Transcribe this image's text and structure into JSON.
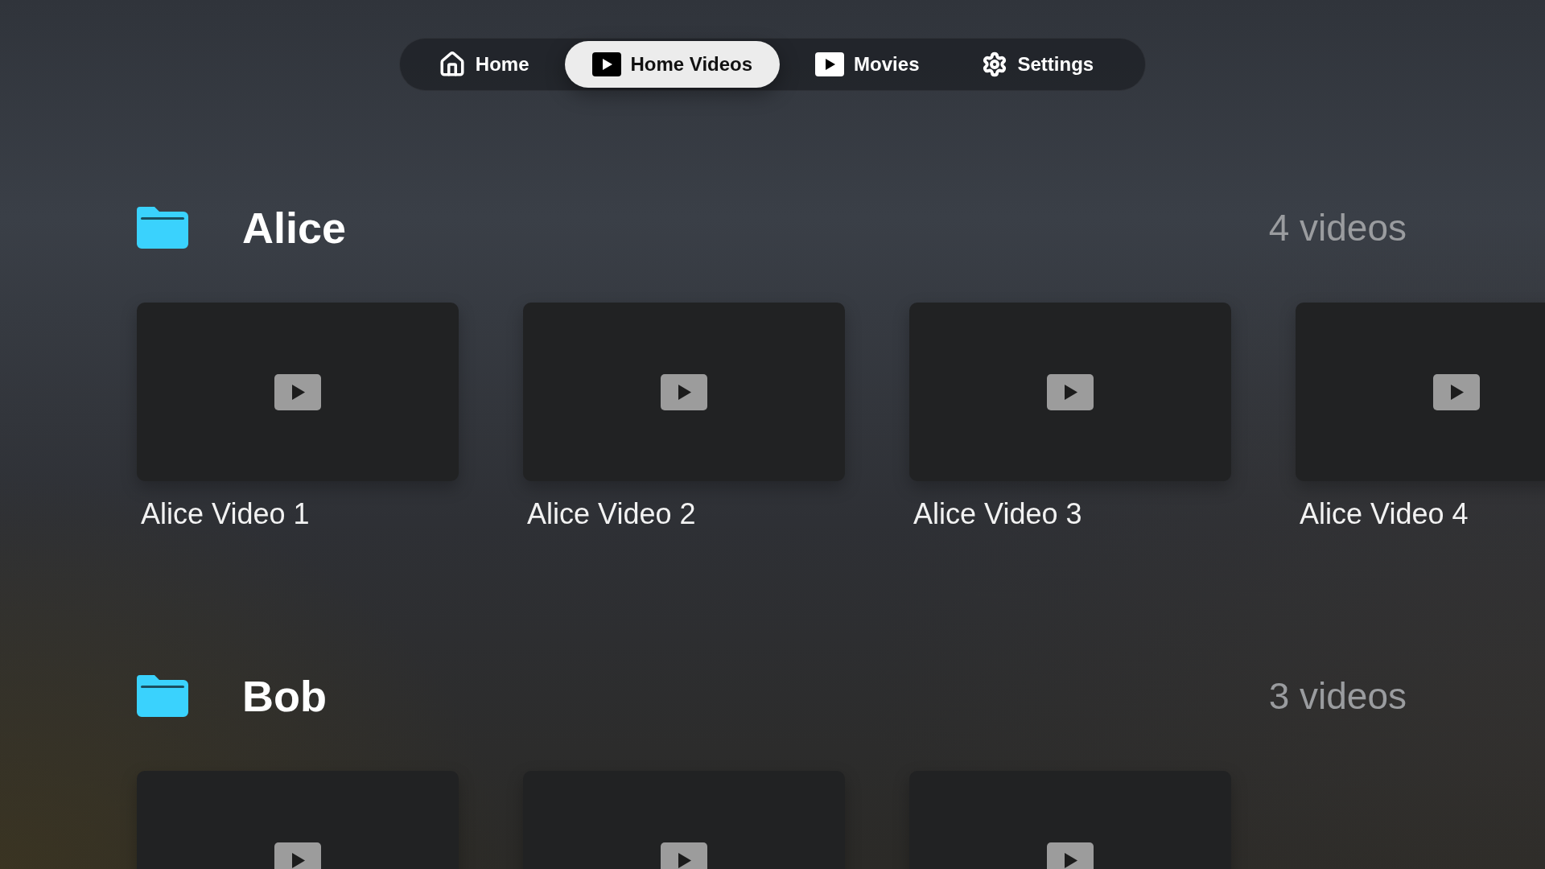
{
  "tabs": [
    {
      "label": "Home",
      "kind": "home",
      "selected": false
    },
    {
      "label": "Home Videos",
      "kind": "video",
      "selected": true
    },
    {
      "label": "Movies",
      "kind": "video",
      "selected": false
    },
    {
      "label": "Settings",
      "kind": "gear",
      "selected": false
    }
  ],
  "sections": [
    {
      "title": "Alice",
      "count": "4 videos",
      "videos": [
        {
          "kind": "video",
          "title": "Alice Video 1"
        },
        {
          "kind": "video",
          "title": "Alice Video 2"
        },
        {
          "kind": "video",
          "title": "Alice Video 3"
        },
        {
          "kind": "video",
          "title": "Alice Video 4"
        }
      ]
    },
    {
      "title": "Bob",
      "count": "3 videos",
      "videos": [
        {
          "kind": "video"
        },
        {
          "kind": "video"
        },
        {
          "kind": "video"
        }
      ]
    }
  ]
}
